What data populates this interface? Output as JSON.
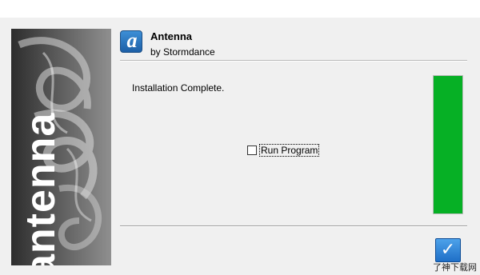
{
  "window": {
    "app_name": "Antenna",
    "publisher": "by Stormdance",
    "banner_text": "antenna",
    "app_icon_glyph": "a"
  },
  "main": {
    "status_text": "Installation Complete.",
    "run_program": {
      "label": "Run Program",
      "checked": false
    }
  },
  "progress": {
    "value_percent": 100,
    "color": "#06b025"
  },
  "footer": {
    "ok_button_glyph": "✓",
    "ok_button_icon": "checkmark-icon"
  },
  "watermark": "了神下载网"
}
